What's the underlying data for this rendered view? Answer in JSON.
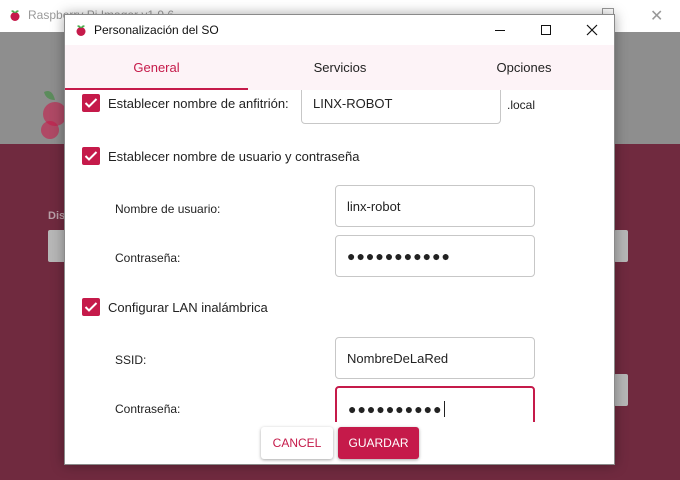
{
  "background": {
    "title": "Raspberry Pi Imager v1.9.6"
  },
  "dialog": {
    "title": "Personalización del SO"
  },
  "tabs": [
    {
      "label": "General"
    },
    {
      "label": "Servicios"
    },
    {
      "label": "Opciones"
    }
  ],
  "hostname": {
    "checkbox_label": "Establecer nombre de anfitrión:",
    "checked": true,
    "value": "LINX-ROBOT",
    "suffix": ".local"
  },
  "user": {
    "checkbox_label": "Establecer nombre de usuario y contraseña",
    "checked": true,
    "username_label": "Nombre de usuario:",
    "username_value": "linx-robot",
    "password_label": "Contraseña:",
    "password_value": "●●●●●●●●●●●"
  },
  "wifi": {
    "checkbox_label": "Configurar LAN inalámbrica",
    "checked": true,
    "ssid_label": "SSID:",
    "ssid_value": "NombreDeLaRed",
    "password_label": "Contraseña:",
    "password_value": "●●●●●●●●●●"
  },
  "buttons": {
    "cancel": "CANCEL",
    "save": "GUARDAR"
  },
  "colors": {
    "accent": "#c51a4a",
    "tab_bg": "#fdf3f7",
    "imager_body": "#702a3f"
  }
}
